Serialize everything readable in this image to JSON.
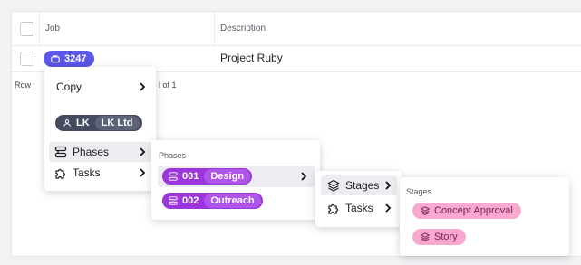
{
  "table": {
    "headers": {
      "job": "Job",
      "description": "Description"
    },
    "row": {
      "job_number": "3247",
      "description": "Project Ruby"
    },
    "footer": {
      "rows_label": "Row",
      "page_of": "l of 1"
    }
  },
  "menu1": {
    "copy": "Copy",
    "company": {
      "code": "LK",
      "name": "LK Ltd"
    },
    "phases": "Phases",
    "tasks": "Tasks"
  },
  "menu2": {
    "section": "Phases",
    "phases": [
      {
        "code": "001",
        "name": "Design"
      },
      {
        "code": "002",
        "name": "Outreach"
      }
    ]
  },
  "menu3": {
    "stages": "Stages",
    "tasks": "Tasks"
  },
  "menu4": {
    "section": "Stages",
    "stages": [
      "Concept Approval",
      "Story"
    ]
  },
  "colors": {
    "job_chip": "#5b57e8",
    "company_chip": "#454b5f",
    "phase_pill": "#9a36db",
    "stage_pill": "#f7a9cf"
  }
}
